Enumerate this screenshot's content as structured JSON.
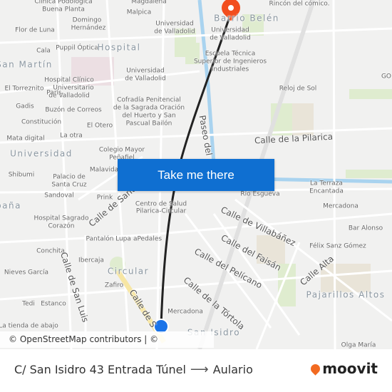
{
  "map": {
    "labels": [
      "Clínica Podológica",
      "Buena Planta",
      "Magdalena",
      "Malpica",
      "Domingo",
      "Hernández",
      "Flor de Luna",
      "Universidad",
      "de Valladolid",
      "Cala",
      "Puppil Óptica",
      "Hospital",
      "San Martín",
      "Universidad",
      "de Valladolid",
      "Hospital Clínico",
      "Universitario",
      "de Valladolid",
      "El Torreznito",
      "París",
      "Gadis",
      "Buzón de Correos",
      "Cofradía Penitencial",
      "de la Sagrada Oración",
      "del Huerto y San",
      "Pascual Bailón",
      "Constitución",
      "El Otero",
      "Mata digital",
      "La otra",
      "Universidad",
      "Colegio Mayor",
      "Peñafiel",
      "Shibumi",
      "Palacio de",
      "Santa Cruz",
      "Malavida",
      "Sandoval",
      "Prink",
      "paña",
      "Centro de Salud",
      "Pilarica-Circular",
      "Hospital Sagrado",
      "Corazón",
      "Pantalón",
      "Lupa",
      "aPedales",
      "Conchita",
      "Ibercaja",
      "Circular",
      "Nieves García",
      "Zafiro",
      "Tedi",
      "Estanco",
      "Mercadona",
      "La tienda de abajo",
      "Rincón del cómico.",
      "Barrio Belén",
      "Universidad",
      "de Valladolid",
      "Escuela Técnica",
      "Superior de Ingenieros",
      "Industriales",
      "Reloj de Sol",
      "GO f",
      "Río Esgueva",
      "La Terraza",
      "Encantada",
      "Mercadona",
      "Bar Alonso",
      "Félix Sanz Gómez",
      "Pajarillos Altos",
      "Olga María",
      "San Isidro"
    ],
    "streets": [
      "Calle de la Pilarica",
      "Paseo del",
      "Calle de Santa",
      "Calle de San Luis",
      "Calle de S",
      "Calle de Villabáñez",
      "Calle del Faisán",
      "Calle del Pelícano",
      "Calle de la Tórtola",
      "Calle Alta"
    ],
    "route_color": "#222222",
    "origin_color": "#1a73e8",
    "destination_color": "#f24e1e"
  },
  "button": {
    "label": "Take me there",
    "color": "#0f6fd1"
  },
  "attribution": "© OpenStreetMap contributors | © OpenMapTiles",
  "footer": {
    "origin": "C/ San Isidro 43 Entrada Túnel",
    "arrow": "⟶",
    "destination": "Aulario",
    "logo": "moovit",
    "logo_color": "#f26a21"
  }
}
